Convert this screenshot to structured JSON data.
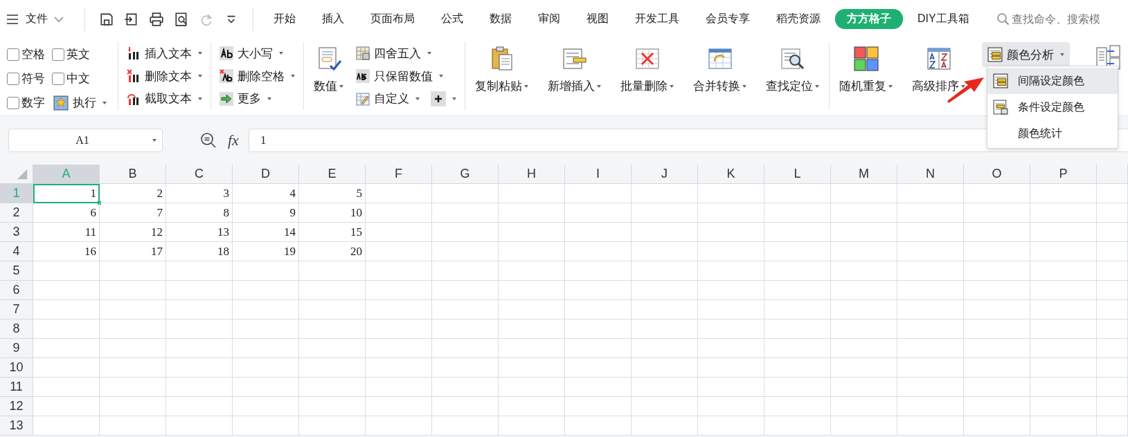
{
  "title_bar": {
    "file_menu": "文件",
    "tabs": [
      {
        "label": "开始",
        "selected": false
      },
      {
        "label": "插入",
        "selected": false
      },
      {
        "label": "页面布局",
        "selected": false
      },
      {
        "label": "公式",
        "selected": false
      },
      {
        "label": "数据",
        "selected": false
      },
      {
        "label": "审阅",
        "selected": false
      },
      {
        "label": "视图",
        "selected": false
      },
      {
        "label": "开发工具",
        "selected": false
      },
      {
        "label": "会员专享",
        "selected": false
      },
      {
        "label": "稻壳资源",
        "selected": false
      },
      {
        "label": "方方格子",
        "selected": true
      },
      {
        "label": "DIY工具箱",
        "selected": false
      }
    ],
    "search": {
      "placeholder": "查找命令、搜索模"
    }
  },
  "ribbon": {
    "filters": [
      {
        "label": "空格",
        "checked": false
      },
      {
        "label": "英文",
        "checked": false
      },
      {
        "label": "符号",
        "checked": false
      },
      {
        "label": "中文",
        "checked": false
      },
      {
        "label": "数字",
        "checked": false
      }
    ],
    "execute_button": "执行",
    "text_tools": [
      "插入文本",
      "删除文本",
      "截取文本"
    ],
    "case_tools": [
      "大小写",
      "删除空格",
      "更多"
    ],
    "number_button": "数值",
    "number_tools": [
      "四舍五入",
      "只保留数值",
      "自定义"
    ],
    "big_buttons": [
      "复制粘贴",
      "新增插入",
      "批量删除",
      "合并转换",
      "查找定位"
    ],
    "more_buttons": [
      "随机重复",
      "高级排序"
    ],
    "color_analysis": {
      "label": "颜色分析",
      "expanded": true,
      "menu": [
        {
          "label": "间隔设定颜色",
          "selected": true,
          "kind": "icon"
        },
        {
          "label": "条件设定颜色",
          "selected": false,
          "kind": "icon"
        },
        {
          "label": "颜色统计",
          "selected": false,
          "kind": "text"
        }
      ]
    }
  },
  "formula_bar": {
    "name_box": "A1",
    "function_label": "fx",
    "value": "1"
  },
  "sheet": {
    "columns": [
      {
        "label": "A",
        "selected": true
      },
      {
        "label": "B",
        "selected": false
      },
      {
        "label": "C",
        "selected": false
      },
      {
        "label": "D",
        "selected": false
      },
      {
        "label": "E",
        "selected": false
      },
      {
        "label": "F",
        "selected": false
      },
      {
        "label": "G",
        "selected": false
      },
      {
        "label": "H",
        "selected": false
      },
      {
        "label": "I",
        "selected": false
      },
      {
        "label": "J",
        "selected": false
      },
      {
        "label": "K",
        "selected": false
      },
      {
        "label": "L",
        "selected": false
      },
      {
        "label": "M",
        "selected": false
      },
      {
        "label": "N",
        "selected": false
      },
      {
        "label": "O",
        "selected": false
      },
      {
        "label": "P",
        "selected": false
      }
    ],
    "rows": [
      {
        "label": "1",
        "selected": true,
        "cells": [
          {
            "value": "1",
            "selected": true
          },
          {
            "value": "2",
            "selected": false
          },
          {
            "value": "3",
            "selected": false
          },
          {
            "value": "4",
            "selected": false
          },
          {
            "value": "5",
            "selected": false
          }
        ]
      },
      {
        "label": "2",
        "selected": false,
        "cells": [
          {
            "value": "6",
            "selected": false
          },
          {
            "value": "7",
            "selected": false
          },
          {
            "value": "8",
            "selected": false
          },
          {
            "value": "9",
            "selected": false
          },
          {
            "value": "10",
            "selected": false
          }
        ]
      },
      {
        "label": "3",
        "selected": false,
        "cells": [
          {
            "value": "11",
            "selected": false
          },
          {
            "value": "12",
            "selected": false
          },
          {
            "value": "13",
            "selected": false
          },
          {
            "value": "14",
            "selected": false
          },
          {
            "value": "15",
            "selected": false
          }
        ]
      },
      {
        "label": "4",
        "selected": false,
        "cells": [
          {
            "value": "16",
            "selected": false
          },
          {
            "value": "17",
            "selected": false
          },
          {
            "value": "18",
            "selected": false
          },
          {
            "value": "19",
            "selected": false
          },
          {
            "value": "20",
            "selected": false
          }
        ]
      },
      {
        "label": "5",
        "selected": false,
        "cells": []
      },
      {
        "label": "6",
        "selected": false,
        "cells": []
      },
      {
        "label": "7",
        "selected": false,
        "cells": []
      },
      {
        "label": "8",
        "selected": false,
        "cells": []
      },
      {
        "label": "9",
        "selected": false,
        "cells": []
      },
      {
        "label": "10",
        "selected": false,
        "cells": []
      },
      {
        "label": "11",
        "selected": false,
        "cells": []
      },
      {
        "label": "12",
        "selected": false,
        "cells": []
      },
      {
        "label": "13",
        "selected": false,
        "cells": []
      }
    ]
  }
}
